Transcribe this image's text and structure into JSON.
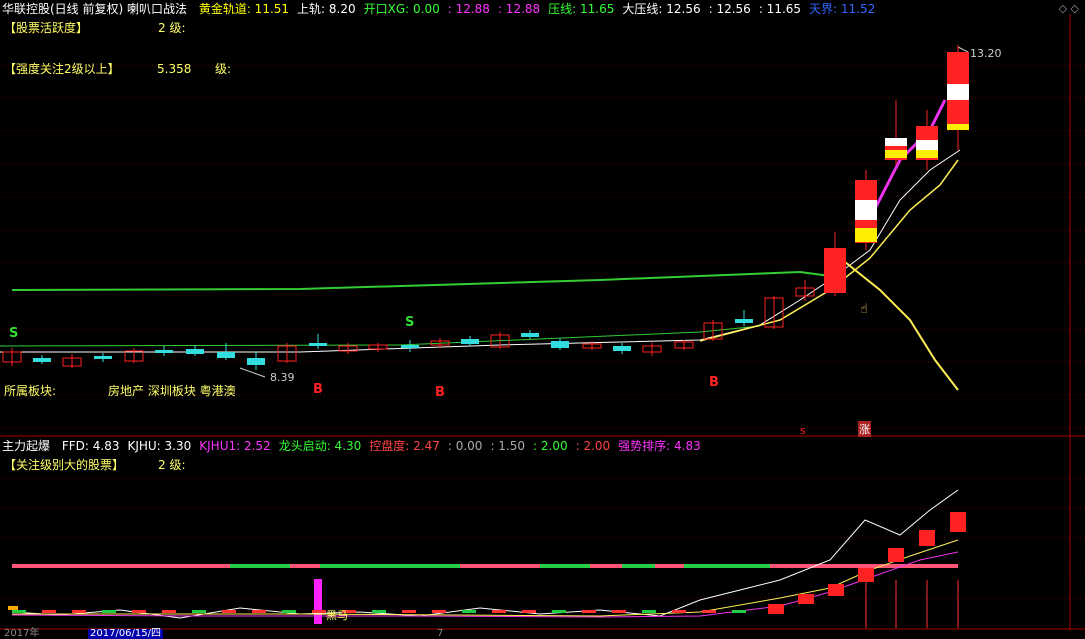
{
  "header": {
    "title": "华联控股(日线 前复权) 喇叭口战法",
    "items": [
      {
        "label": "黄金轨道: 11.51",
        "color": "#ffff00"
      },
      {
        "label": "上轨: 8.20",
        "color": "#ffffff"
      },
      {
        "label": "开口XG: 0.00",
        "color": "#33ff33"
      },
      {
        "label": ": 12.88",
        "color": "#ff33ff"
      },
      {
        "label": ": 12.88",
        "color": "#ff33ff"
      },
      {
        "label": "压线: 11.65",
        "color": "#33ff33"
      },
      {
        "label": "大压线: 12.56",
        "color": "#ffffff"
      },
      {
        "label": ": 12.56",
        "color": "#ffffff"
      },
      {
        "label": ": 11.65",
        "color": "#ffffff"
      },
      {
        "label": "天界: 11.52",
        "color": "#3366ff"
      }
    ],
    "corner_icons": "◇ ◇"
  },
  "upper_info": {
    "activity_label": "【股票活跃度】",
    "activity_value": "2  级:",
    "focus_label": "【强度关注2级以上】",
    "focus_value": "5.358",
    "focus_unit": "级:",
    "sector_label": "所属板块:",
    "sector_value": "房地产 深圳板块 粤港澳"
  },
  "price_labels": {
    "high": "13.20",
    "low": "8.39"
  },
  "signals": {
    "s": "S",
    "b": "B",
    "zhang": "涨",
    "small_s": "s"
  },
  "lower_header": {
    "title": "主力起爆",
    "items": [
      {
        "label": "FFD: 4.83",
        "color": "#ffffff"
      },
      {
        "label": "KJHU: 3.30",
        "color": "#ffffff"
      },
      {
        "label": "KJHU1: 2.52",
        "color": "#ff33ff"
      },
      {
        "label": "龙头启动: 4.30",
        "color": "#33ff33"
      },
      {
        "label": "控盘度: 2.47",
        "color": "#ff4444"
      },
      {
        "label": ": 0.00",
        "color": "#aaaaaa"
      },
      {
        "label": ": 1.50",
        "color": "#aaaaaa"
      },
      {
        "label": ": 2.00",
        "color": "#33ff33"
      },
      {
        "label": ": 2.00",
        "color": "#ff4444"
      },
      {
        "label": "强势排序: 4.83",
        "color": "#ff33ff"
      }
    ]
  },
  "lower_info": {
    "focus_big_label": "【关注级别大的股票】",
    "focus_big_value": "2  级:",
    "horse_label": "黑马"
  },
  "bottom_axis": {
    "year_label": "2017年",
    "date_label": "2017/06/15/四",
    "tick": "7"
  },
  "colors": {
    "up": "#ff2222",
    "down": "#33dddd",
    "ma_green": "#33cc33",
    "ma_yellow": "#ffee55",
    "ma_white": "#ffffff",
    "ma_magenta": "#ee33ee",
    "grid": "#8b0000"
  }
}
